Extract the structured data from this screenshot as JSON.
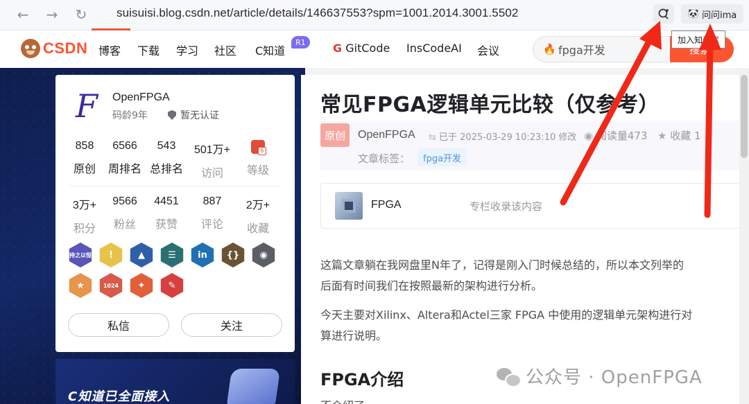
{
  "browser": {
    "url": "suisuisi.blog.csdn.net/article/details/146637553?spm=1001.2014.3001.5502",
    "ima_label": "问问ima",
    "tooltip": "加入知识库"
  },
  "toolbar": {
    "logo": "CSDN",
    "nav": [
      "博客",
      "下载",
      "学习",
      "社区",
      "C知道",
      "GitCode",
      "InsCodeAI",
      "会议"
    ],
    "cknow_badge": "R1",
    "search_value": "fpga开发",
    "search_button": "搜索"
  },
  "profile": {
    "name": "OpenFPGA",
    "code_age": "码龄9年",
    "cert": "暂无认证",
    "stats_row1": [
      {
        "num": "858",
        "label": "原创"
      },
      {
        "num": "6566",
        "label": "周排名"
      },
      {
        "num": "543",
        "label": "总排名"
      },
      {
        "num": "501万+",
        "label": "访问"
      },
      {
        "num": "",
        "label": "等级"
      }
    ],
    "stats_row2": [
      {
        "num": "3万+",
        "label": "积分"
      },
      {
        "num": "9566",
        "label": "粉丝"
      },
      {
        "num": "4451",
        "label": "获赞"
      },
      {
        "num": "887",
        "label": "评论"
      },
      {
        "num": "2万+",
        "label": "收藏"
      }
    ],
    "badges": [
      {
        "name": "ranking-badge-icon",
        "color": "#5a55b8",
        "text": "持之以恒"
      },
      {
        "name": "idea-badge-icon",
        "color": "#e8c34a",
        "text": "!"
      },
      {
        "name": "rocket-badge-icon",
        "color": "#2f5fa8",
        "text": "▲"
      },
      {
        "name": "list-badge-icon",
        "color": "#2b6f73",
        "text": "☰"
      },
      {
        "name": "linkedin-badge-icon",
        "color": "#1f6fb2",
        "text": "in"
      },
      {
        "name": "code-badge-icon",
        "color": "#6a5334",
        "text": "{}"
      },
      {
        "name": "github-badge-icon",
        "color": "#5a5f66",
        "text": "◉"
      },
      {
        "name": "star-badge-icon",
        "color": "#e8944a",
        "text": "★"
      },
      {
        "name": "1024-badge-icon",
        "color": "#d85a4a",
        "text": "1024"
      },
      {
        "name": "medal-badge-icon",
        "color": "#e0603a",
        "text": "✦"
      },
      {
        "name": "pen-badge-icon",
        "color": "#d84040",
        "text": "✎"
      }
    ],
    "message_button": "私信",
    "follow_button": "关注"
  },
  "promo": {
    "text": "C知道已全面接入"
  },
  "article": {
    "title": "常见FPGA逻辑单元比较（仅参考）",
    "orig_badge": "原创",
    "author": "OpenFPGA",
    "time": "已于 2025-03-29 10:23:10 修改",
    "reads": "阅读量473",
    "favs": "收藏 1",
    "tag_label": "文章标签：",
    "tag": "fpga开发",
    "column_name": "FPGA",
    "column_note": "专栏收录该内容",
    "para1_line1": "这篇文章躺在我网盘里N年了，记得是刚入门时候总结的，所以本文列举的",
    "para1_line2": "后面有时间我们在按照最新的架构进行分析。",
    "para2_line1": "今天主要对Xilinx、Altera和Actel三家 FPGA 中使用的逻辑单元架构进行对",
    "para2_line2": "算进行说明。",
    "h2": "FPGA介绍",
    "small": "不介绍了"
  },
  "watermark": "公众号 · OpenFPGA",
  "colors": {
    "brand": "#fc5531",
    "arrow": "#f02818",
    "dark_bg": "#132866"
  }
}
